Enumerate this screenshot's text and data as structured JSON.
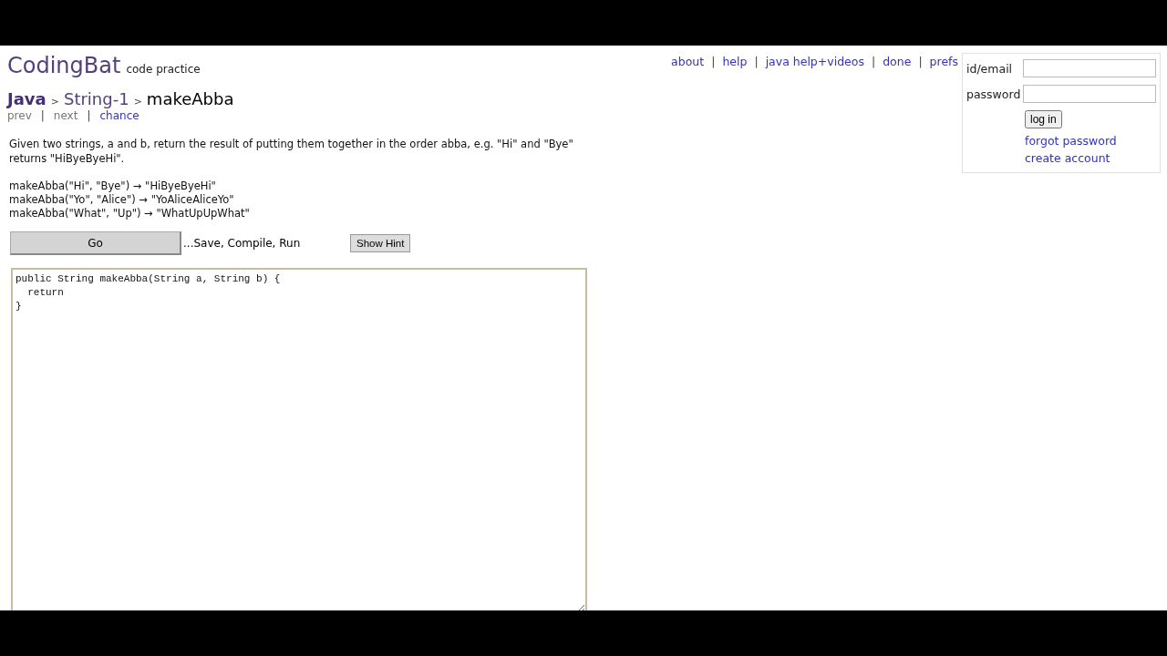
{
  "logo": {
    "name": "CodingBat",
    "tagline": "code practice"
  },
  "nav": [
    {
      "kind": "link",
      "text": "about"
    },
    {
      "kind": "sep",
      "text": "|"
    },
    {
      "kind": "link",
      "text": "help"
    },
    {
      "kind": "sep",
      "text": "|"
    },
    {
      "kind": "link",
      "text": "java help+videos"
    },
    {
      "kind": "sep",
      "text": "|"
    },
    {
      "kind": "link",
      "text": "done"
    },
    {
      "kind": "sep",
      "text": "|"
    },
    {
      "kind": "link",
      "text": "prefs"
    }
  ],
  "login": {
    "id_label": "id/email",
    "password_label": "password",
    "button": "log in",
    "links": [
      "forgot password",
      "create account"
    ]
  },
  "breadcrumb": [
    {
      "kind": "lang",
      "text": "Java"
    },
    {
      "kind": "sep",
      "text": ">"
    },
    {
      "kind": "section",
      "text": "String-1"
    },
    {
      "kind": "sep",
      "text": ">"
    },
    {
      "kind": "current",
      "text": "makeAbba"
    }
  ],
  "pager": [
    {
      "kind": "link",
      "text": "prev",
      "disabled": true
    },
    {
      "kind": "sep",
      "text": "|"
    },
    {
      "kind": "link",
      "text": "next",
      "disabled": true
    },
    {
      "kind": "sep",
      "text": "|"
    },
    {
      "kind": "link",
      "text": "chance",
      "disabled": false
    }
  ],
  "description": "Given two strings, a and b, return the result of putting them together in the order abba, e.g. \"Hi\" and \"Bye\" returns \"HiByeByeHi\".",
  "examples": [
    "makeAbba(\"Hi\", \"Bye\") → \"HiByeByeHi\"",
    "makeAbba(\"Yo\", \"Alice\") → \"YoAliceAliceYo\"",
    "makeAbba(\"What\", \"Up\") → \"WhatUpUpWhat\""
  ],
  "go_button": "Go",
  "go_note": "...Save, Compile, Run",
  "hint_button": "Show Hint",
  "code": "public String makeAbba(String a, String b) {\n  return\n}"
}
